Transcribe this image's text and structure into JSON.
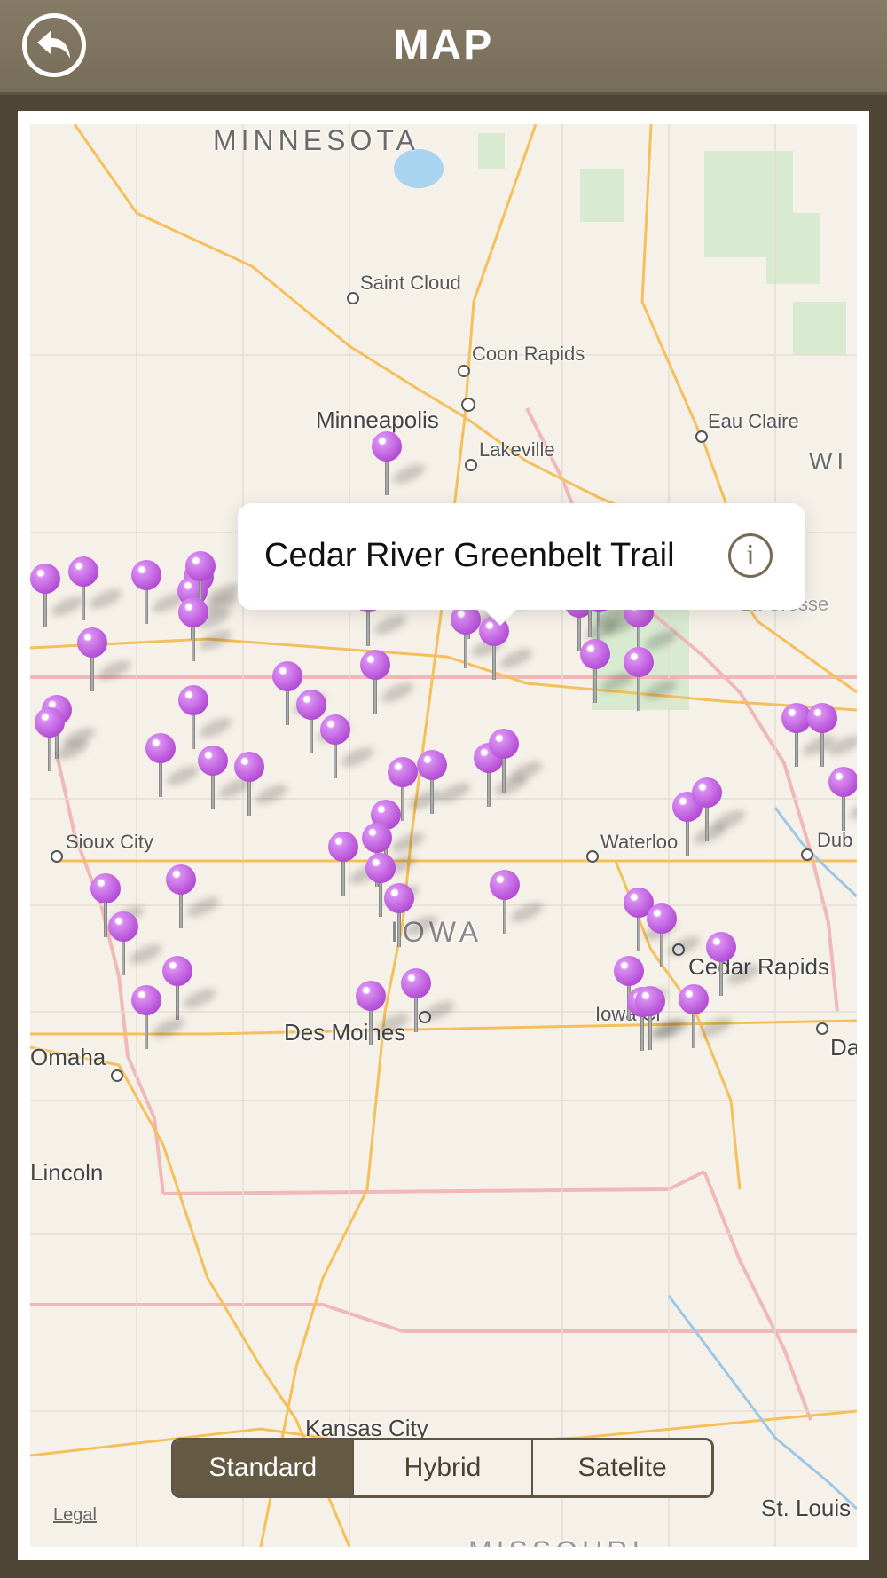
{
  "header": {
    "title": "MAP",
    "back_icon": "back-arrow-icon"
  },
  "map": {
    "labels": {
      "minnesota": "MINNESOTA",
      "saint_cloud": "Saint Cloud",
      "coon_rapids": "Coon Rapids",
      "minneapolis": "Minneapolis",
      "eau_claire": "Eau Claire",
      "lakeville": "Lakeville",
      "wi": "WI",
      "la_crosse": "La Crosse",
      "sioux_city": "Sioux City",
      "waterloo": "Waterloo",
      "dub": "Dub",
      "iowa": "IOWA",
      "cedar_rapids": "Cedar Rapids",
      "iowa_city": "Iowa Ci",
      "des_moines": "Des Moines",
      "omaha": "Omaha",
      "da": "Da",
      "lincoln": "Lincoln",
      "kansas_city": "Kansas City",
      "st_louis": "St. Louis",
      "missouri": "MISSOURI"
    },
    "callout": {
      "title": "Cedar River Greenbelt Trail",
      "info_icon": "info-icon"
    },
    "pin_color": "#b54fd6",
    "legal": "Legal"
  },
  "segment": {
    "standard": "Standard",
    "hybrid": "Hybrid",
    "satellite": "Satelite",
    "selected": "Standard"
  },
  "colors": {
    "header": "#7f7561",
    "accent": "#655a44"
  }
}
